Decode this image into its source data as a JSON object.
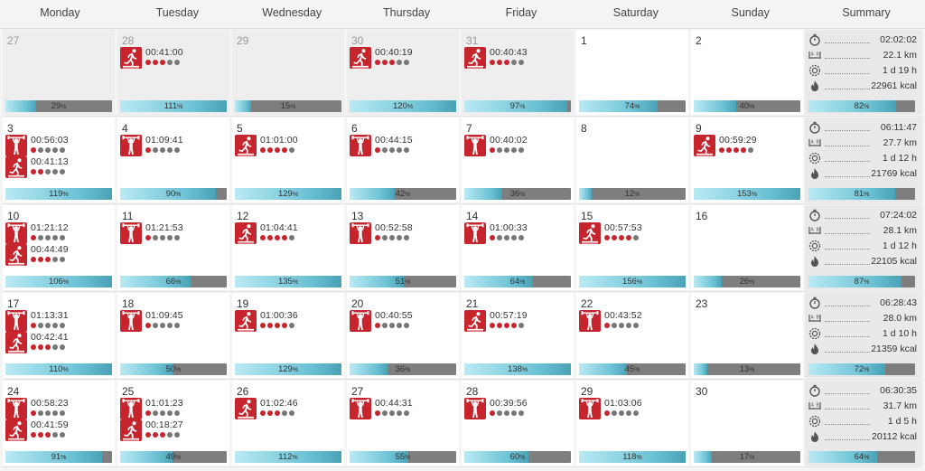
{
  "days": [
    "Monday",
    "Tuesday",
    "Wednesday",
    "Thursday",
    "Friday",
    "Saturday",
    "Sunday"
  ],
  "summary_header": "Summary",
  "weeks": [
    {
      "cells": [
        {
          "date": "27",
          "muted": true,
          "acts": [],
          "progress": "29"
        },
        {
          "date": "28",
          "muted": true,
          "acts": [
            {
              "type": "run",
              "time": "00:41:00",
              "dots": 3
            }
          ],
          "progress": "111"
        },
        {
          "date": "29",
          "muted": true,
          "acts": [],
          "progress": "15"
        },
        {
          "date": "30",
          "muted": true,
          "acts": [
            {
              "type": "run",
              "time": "00:40:19",
              "dots": 3
            }
          ],
          "progress": "120"
        },
        {
          "date": "31",
          "muted": true,
          "acts": [
            {
              "type": "run",
              "time": "00:40:43",
              "dots": 3
            }
          ],
          "progress": "97"
        },
        {
          "date": "1",
          "muted": false,
          "acts": [],
          "progress": "74"
        },
        {
          "date": "2",
          "muted": false,
          "acts": [],
          "progress": "40"
        }
      ],
      "summary": {
        "time": "02:02:02",
        "distance": "22.1 km",
        "duration": "1 d 19 h",
        "energy": "22961 kcal",
        "progress": "82"
      }
    },
    {
      "cells": [
        {
          "date": "3",
          "muted": false,
          "acts": [
            {
              "type": "gym",
              "time": "00:56:03",
              "dots": 1
            },
            {
              "type": "run",
              "time": "00:41:13",
              "dots": 2
            }
          ],
          "progress": "119"
        },
        {
          "date": "4",
          "muted": false,
          "acts": [
            {
              "type": "gym",
              "time": "01:09:41",
              "dots": 1
            }
          ],
          "progress": "90"
        },
        {
          "date": "5",
          "muted": false,
          "acts": [
            {
              "type": "run",
              "time": "01:01:00",
              "dots": 4
            }
          ],
          "progress": "129"
        },
        {
          "date": "6",
          "muted": false,
          "acts": [
            {
              "type": "gym",
              "time": "00:44:15",
              "dots": 1
            }
          ],
          "progress": "42"
        },
        {
          "date": "7",
          "muted": false,
          "acts": [
            {
              "type": "gym",
              "time": "00:40:02",
              "dots": 1
            }
          ],
          "progress": "36"
        },
        {
          "date": "8",
          "muted": false,
          "acts": [],
          "progress": "12"
        },
        {
          "date": "9",
          "muted": false,
          "acts": [
            {
              "type": "run",
              "time": "00:59:29",
              "dots": 4
            }
          ],
          "progress": "153"
        }
      ],
      "summary": {
        "time": "06:11:47",
        "distance": "27.7 km",
        "duration": "1 d 12 h",
        "energy": "21769 kcal",
        "progress": "81"
      }
    },
    {
      "cells": [
        {
          "date": "10",
          "muted": false,
          "acts": [
            {
              "type": "gym",
              "time": "01:21:12",
              "dots": 1
            },
            {
              "type": "run",
              "time": "00:44:49",
              "dots": 3
            }
          ],
          "progress": "106"
        },
        {
          "date": "11",
          "muted": false,
          "acts": [
            {
              "type": "gym",
              "time": "01:21:53",
              "dots": 1
            }
          ],
          "progress": "66"
        },
        {
          "date": "12",
          "muted": false,
          "acts": [
            {
              "type": "run",
              "time": "01:04:41",
              "dots": 4
            }
          ],
          "progress": "135"
        },
        {
          "date": "13",
          "muted": false,
          "acts": [
            {
              "type": "gym",
              "time": "00:52:58",
              "dots": 1
            }
          ],
          "progress": "51"
        },
        {
          "date": "14",
          "muted": false,
          "acts": [
            {
              "type": "gym",
              "time": "01:00:33",
              "dots": 1
            }
          ],
          "progress": "64"
        },
        {
          "date": "15",
          "muted": false,
          "acts": [
            {
              "type": "run",
              "time": "00:57:53",
              "dots": 4
            }
          ],
          "progress": "156"
        },
        {
          "date": "16",
          "muted": false,
          "acts": [],
          "progress": "26"
        }
      ],
      "summary": {
        "time": "07:24:02",
        "distance": "28.1 km",
        "duration": "1 d 12 h",
        "energy": "22105 kcal",
        "progress": "87"
      }
    },
    {
      "cells": [
        {
          "date": "17",
          "muted": false,
          "acts": [
            {
              "type": "gym",
              "time": "01:13:31",
              "dots": 1
            },
            {
              "type": "run",
              "time": "00:42:41",
              "dots": 3
            }
          ],
          "progress": "110"
        },
        {
          "date": "18",
          "muted": false,
          "acts": [
            {
              "type": "gym",
              "time": "01:09:45",
              "dots": 1
            }
          ],
          "progress": "50"
        },
        {
          "date": "19",
          "muted": false,
          "acts": [
            {
              "type": "run",
              "time": "01:00:36",
              "dots": 4
            }
          ],
          "progress": "129"
        },
        {
          "date": "20",
          "muted": false,
          "acts": [
            {
              "type": "gym",
              "time": "00:40:55",
              "dots": 1
            }
          ],
          "progress": "36"
        },
        {
          "date": "21",
          "muted": false,
          "acts": [
            {
              "type": "run",
              "time": "00:57:19",
              "dots": 4
            }
          ],
          "progress": "138"
        },
        {
          "date": "22",
          "muted": false,
          "acts": [
            {
              "type": "gym",
              "time": "00:43:52",
              "dots": 1
            }
          ],
          "progress": "45"
        },
        {
          "date": "23",
          "muted": false,
          "acts": [],
          "progress": "13"
        }
      ],
      "summary": {
        "time": "06:28:43",
        "distance": "28.0 km",
        "duration": "1 d 10 h",
        "energy": "21359 kcal",
        "progress": "72"
      }
    },
    {
      "cells": [
        {
          "date": "24",
          "muted": false,
          "acts": [
            {
              "type": "gym",
              "time": "00:58:23",
              "dots": 1
            },
            {
              "type": "run",
              "time": "00:41:59",
              "dots": 3
            }
          ],
          "progress": "91"
        },
        {
          "date": "25",
          "muted": false,
          "acts": [
            {
              "type": "gym",
              "time": "01:01:23",
              "dots": 1
            },
            {
              "type": "run",
              "time": "00:18:27",
              "dots": 3
            }
          ],
          "progress": "49"
        },
        {
          "date": "26",
          "muted": false,
          "acts": [
            {
              "type": "run",
              "time": "01:02:46",
              "dots": 3
            }
          ],
          "progress": "112"
        },
        {
          "date": "27",
          "muted": false,
          "acts": [
            {
              "type": "gym",
              "time": "00:44:31",
              "dots": 1
            }
          ],
          "progress": "55"
        },
        {
          "date": "28",
          "muted": false,
          "acts": [
            {
              "type": "gym",
              "time": "00:39:56",
              "dots": 1
            }
          ],
          "progress": "60"
        },
        {
          "date": "29",
          "muted": false,
          "acts": [
            {
              "type": "gym",
              "time": "01:03:06",
              "dots": 1
            }
          ],
          "progress": "118"
        },
        {
          "date": "30",
          "muted": false,
          "acts": [],
          "progress": "17"
        }
      ],
      "summary": {
        "time": "06:30:35",
        "distance": "31.7 km",
        "duration": "1 d 5 h",
        "energy": "20112 kcal",
        "progress": "64"
      }
    }
  ],
  "percent_sign": "%",
  "dots_total": 5,
  "icons": {
    "run": "running-icon",
    "gym": "strength-training-icon",
    "time": "stopwatch-icon",
    "distance": "distance-icon",
    "duration": "recovery-icon",
    "energy": "flame-icon"
  },
  "colors": {
    "activity_red": "#c7252e",
    "progress_fill": "#6bc1d4",
    "progress_track": "#7e7e7e",
    "muted_cell": "#eeeeee"
  }
}
